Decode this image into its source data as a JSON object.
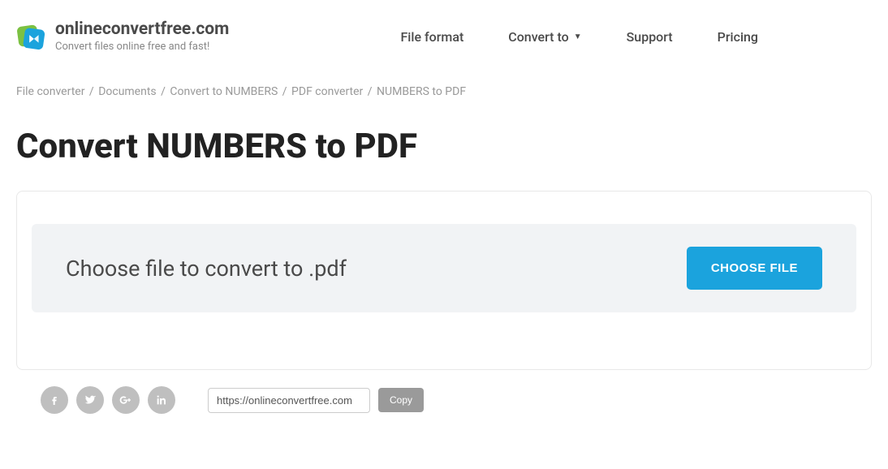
{
  "header": {
    "logo_title": "onlineconvertfree.com",
    "logo_tagline": "Convert files online free and fast!"
  },
  "nav": {
    "file_format": "File format",
    "convert_to": "Convert to",
    "support": "Support",
    "pricing": "Pricing"
  },
  "breadcrumb": {
    "items": [
      "File converter",
      "Documents",
      "Convert to NUMBERS",
      "PDF converter",
      "NUMBERS to PDF"
    ]
  },
  "page": {
    "title": "Convert NUMBERS to PDF"
  },
  "converter": {
    "choose_label": "Choose file to convert to .pdf",
    "choose_button": "CHOOSE FILE"
  },
  "share": {
    "url_value": "https://onlineconvertfree.com",
    "copy_label": "Copy"
  }
}
